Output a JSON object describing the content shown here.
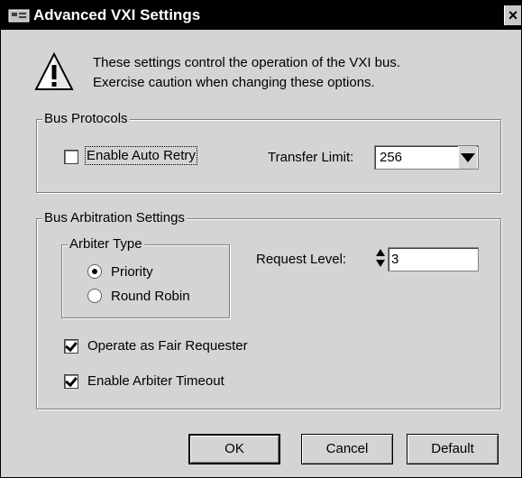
{
  "window": {
    "title": "Advanced VXI Settings",
    "close_glyph": "×",
    "app_icon": "vxi-app-icon"
  },
  "warning": {
    "icon": "warning-exclamation-icon",
    "line1": "These settings control the operation of the VXI bus.",
    "line2": "Exercise caution when changing these options."
  },
  "bus_protocols": {
    "group_label": "Bus Protocols",
    "auto_retry": {
      "label": "Enable Auto Retry",
      "checked": false
    },
    "transfer_limit": {
      "label": "Transfer Limit:",
      "value": "256"
    }
  },
  "bus_arbitration": {
    "group_label": "Bus Arbitration Settings",
    "arbiter_type": {
      "group_label": "Arbiter Type",
      "options": [
        {
          "label": "Priority",
          "selected": true
        },
        {
          "label": "Round Robin",
          "selected": false
        }
      ]
    },
    "request_level": {
      "label": "Request Level:",
      "value": "3"
    },
    "fair_requester": {
      "label": "Operate as Fair Requester",
      "checked": true
    },
    "arbiter_timeout": {
      "label": "Enable Arbiter Timeout",
      "checked": true
    }
  },
  "buttons": {
    "ok": "OK",
    "cancel": "Cancel",
    "default": "Default"
  },
  "colors": {
    "dialog_bg": "#d4d4d4",
    "titlebar_bg": "#000000",
    "titlebar_text": "#ffffff"
  }
}
